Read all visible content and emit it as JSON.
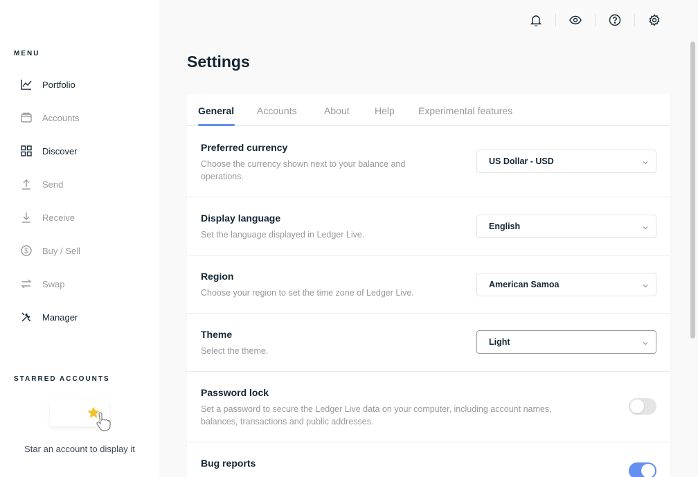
{
  "sidebar": {
    "menu_title": "MENU",
    "items": [
      {
        "label": "Portfolio",
        "icon": "portfolio-icon",
        "enabled": true
      },
      {
        "label": "Accounts",
        "icon": "accounts-icon",
        "enabled": false
      },
      {
        "label": "Discover",
        "icon": "discover-icon",
        "enabled": true
      },
      {
        "label": "Send",
        "icon": "send-icon",
        "enabled": false
      },
      {
        "label": "Receive",
        "icon": "receive-icon",
        "enabled": false
      },
      {
        "label": "Buy / Sell",
        "icon": "buy-sell-icon",
        "enabled": false
      },
      {
        "label": "Swap",
        "icon": "swap-icon",
        "enabled": false
      },
      {
        "label": "Manager",
        "icon": "manager-icon",
        "enabled": true
      }
    ],
    "starred_title": "STARRED ACCOUNTS",
    "starred_hint": "Star an account to display it"
  },
  "topbar": {
    "icons": [
      "bell-icon",
      "eye-icon",
      "help-icon",
      "gear-icon"
    ]
  },
  "page": {
    "title": "Settings"
  },
  "tabs": [
    {
      "label": "General",
      "active": true
    },
    {
      "label": "Accounts",
      "active": false
    },
    {
      "label": "About",
      "active": false
    },
    {
      "label": "Help",
      "active": false
    },
    {
      "label": "Experimental features",
      "active": false
    }
  ],
  "settings": {
    "currency": {
      "title": "Preferred currency",
      "desc": "Choose the currency shown next to your balance and operations.",
      "value": "US Dollar - USD"
    },
    "language": {
      "title": "Display language",
      "desc": "Set the language displayed in Ledger Live.",
      "value": "English"
    },
    "region": {
      "title": "Region",
      "desc": "Choose your region to set the time zone of Ledger Live.",
      "value": "American Samoa"
    },
    "theme": {
      "title": "Theme",
      "desc": "Select the theme.",
      "value": "Light"
    },
    "password": {
      "title": "Password lock",
      "desc": "Set a password to secure the Ledger Live data on your computer, including account names, balances, transactions and public addresses.",
      "enabled": false
    },
    "bug_reports": {
      "title": "Bug reports",
      "enabled": true
    }
  },
  "colors": {
    "accent": "#6490f1",
    "text_primary": "#142533",
    "text_muted": "#999999",
    "star": "#f4c430"
  }
}
